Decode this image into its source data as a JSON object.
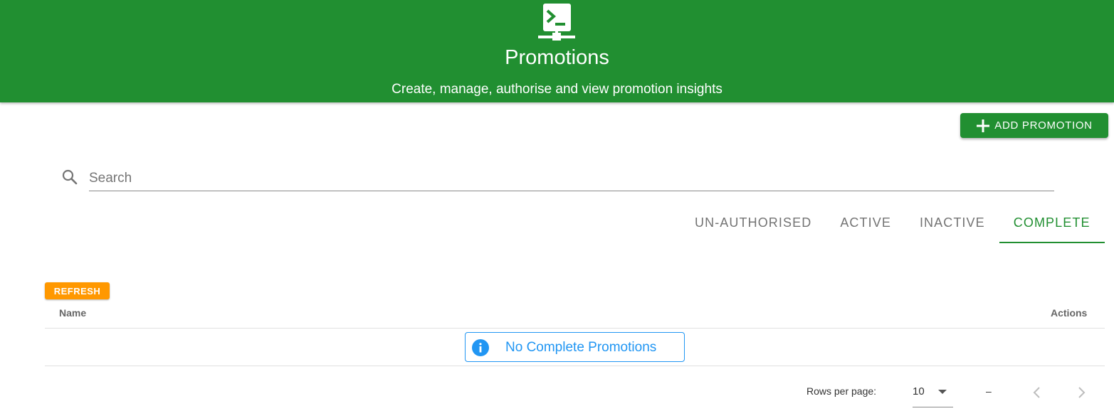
{
  "header": {
    "icon": "terminal-network-icon",
    "title": "Promotions",
    "subtitle": "Create, manage, authorise and view promotion insights",
    "background": "#218f31"
  },
  "toolbar": {
    "add_label": "ADD PROMOTION",
    "add_icon": "plus-icon"
  },
  "search": {
    "placeholder": "Search",
    "value": "",
    "icon": "search-icon"
  },
  "tabs": [
    {
      "label": "UN-AUTHORISED",
      "active": false
    },
    {
      "label": "ACTIVE",
      "active": false
    },
    {
      "label": "INACTIVE",
      "active": false
    },
    {
      "label": "COMPLETE",
      "active": true
    }
  ],
  "refresh_label": "REFRESH",
  "table": {
    "columns": [
      "Name",
      "Actions"
    ],
    "empty_message": "No Complete Promotions"
  },
  "pagination": {
    "rows_label": "Rows per page:",
    "rows_value": "10",
    "range": "–"
  },
  "colors": {
    "primary": "#218f31",
    "refresh": "#ff9800",
    "info": "#2196f3"
  }
}
